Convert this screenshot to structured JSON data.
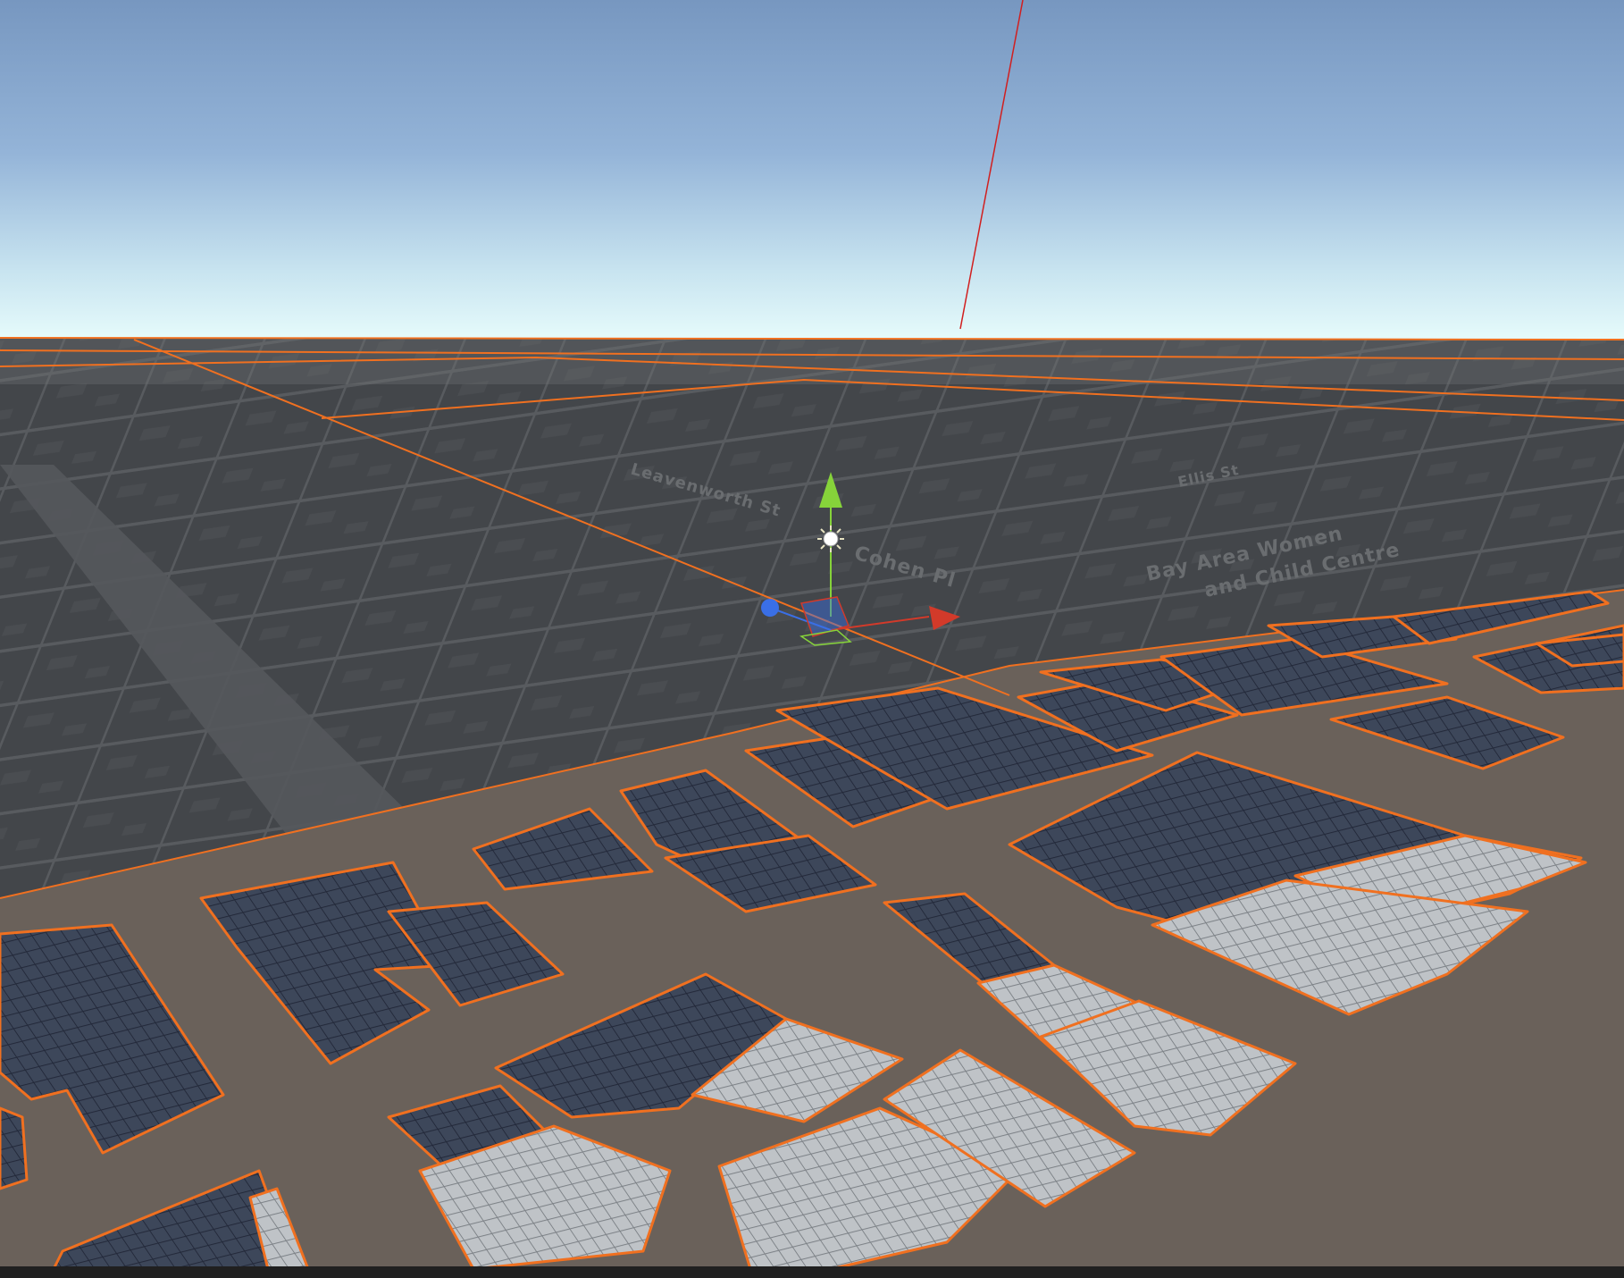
{
  "scene_view": {
    "street_labels": [
      "Leavenworth St",
      "Cohen Pl",
      "Ellis St",
      "Bay Area Women",
      "and Child Centre"
    ],
    "gizmo": {
      "axes": [
        "x-axis-arrow",
        "y-axis-arrow",
        "z-axis-handle"
      ],
      "light": "directional-light-icon"
    }
  },
  "colors": {
    "sky_top": "#7b9bc4",
    "sky_horizon": "#e4f8fb",
    "map_ground": "#44474a",
    "map_roads": "#5d6063",
    "terrain": "#6b625b",
    "roads_brown": "#7a6c61",
    "building_outline": "#f07020",
    "building_tile_dark": "#3f4a5e",
    "building_tile_light": "#b9bcc0",
    "axis_x": "#d23a2a",
    "axis_y": "#86d33a",
    "axis_z": "#3a6fe6"
  }
}
